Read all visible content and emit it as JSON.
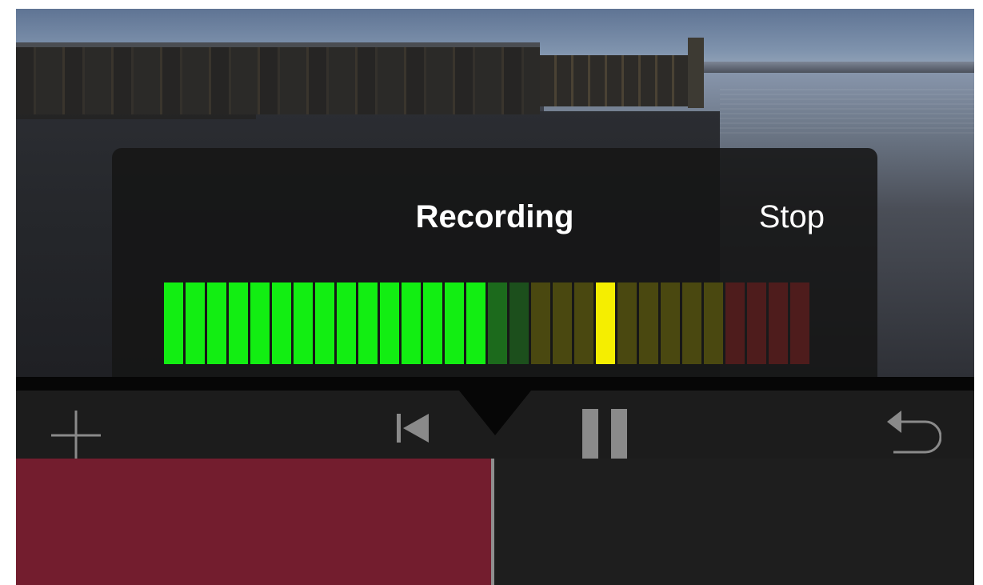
{
  "recording": {
    "title": "Recording",
    "stop_label": "Stop"
  },
  "meter": {
    "peak_segment": 21,
    "segments": [
      {
        "color": "#12ee12"
      },
      {
        "color": "#12ee12"
      },
      {
        "color": "#12ee12"
      },
      {
        "color": "#12ee12"
      },
      {
        "color": "#12ee12"
      },
      {
        "color": "#12ee12"
      },
      {
        "color": "#12ee12"
      },
      {
        "color": "#12ee12"
      },
      {
        "color": "#12ee12"
      },
      {
        "color": "#12ee12"
      },
      {
        "color": "#12ee12"
      },
      {
        "color": "#12ee12"
      },
      {
        "color": "#12ee12"
      },
      {
        "color": "#12ee12"
      },
      {
        "color": "#12ee12"
      },
      {
        "color": "#1c6a1c"
      },
      {
        "color": "#1c4f1c"
      },
      {
        "color": "#4a4810"
      },
      {
        "color": "#4a4810"
      },
      {
        "color": "#4a4810"
      },
      {
        "color": "#f5ee00"
      },
      {
        "color": "#4a4810"
      },
      {
        "color": "#4a4810"
      },
      {
        "color": "#4a4810"
      },
      {
        "color": "#4a4810"
      },
      {
        "color": "#4a4810"
      },
      {
        "color": "#4e1c1c"
      },
      {
        "color": "#4e1c1c"
      },
      {
        "color": "#4e1c1c"
      },
      {
        "color": "#4e1c1c"
      }
    ]
  },
  "toolbar": {
    "icons": [
      "plus-icon",
      "skip-to-start-icon",
      "pause-icon",
      "undo-icon"
    ]
  },
  "colors": {
    "clip": "#731d2e",
    "playhead": "#8f8f8f",
    "toolbar_icon": "#8a8a8a"
  }
}
